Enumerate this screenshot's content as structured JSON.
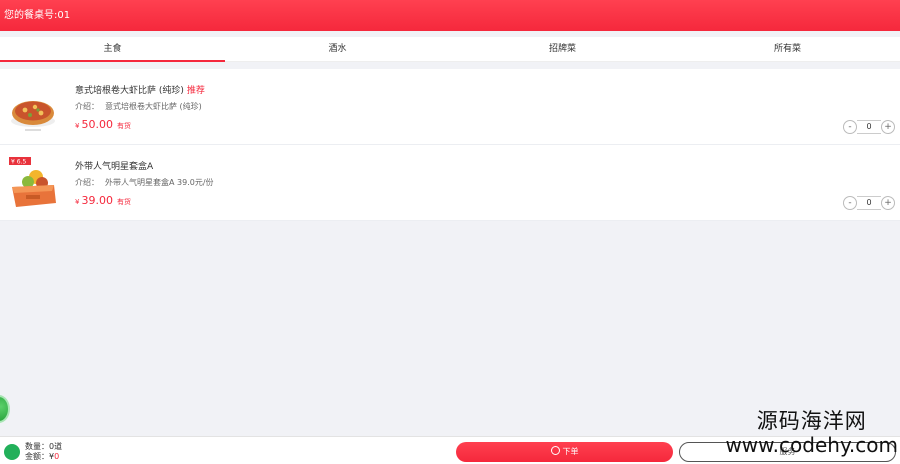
{
  "header": {
    "table_label": "您的餐桌号:01"
  },
  "tabs": [
    {
      "label": "主食",
      "active": true
    },
    {
      "label": "酒水",
      "active": false
    },
    {
      "label": "招牌菜",
      "active": false
    },
    {
      "label": "所有菜",
      "active": false
    }
  ],
  "items": [
    {
      "name": "意式培根卷大虾比萨 (纯珍)",
      "tag": "推荐",
      "desc_label": "介绍：",
      "desc": "意式培根卷大虾比萨 (纯珍)",
      "currency": "¥",
      "price": "50.00",
      "stock": "有货",
      "qty": "0",
      "image": "pizza"
    },
    {
      "name": "外带人气明星套盒A",
      "tag": "",
      "desc_label": "介绍：",
      "desc": "外带人气明星套盒A 39.0元/份",
      "currency": "¥",
      "price": "39.00",
      "stock": "有货",
      "qty": "0",
      "image": "meal-box",
      "badge": "¥ 6.5"
    }
  ],
  "stepper": {
    "minus": "-",
    "plus": "+"
  },
  "footer": {
    "qty_label": "数量：",
    "qty_value": "0道",
    "amount_label": "金额：¥",
    "amount_value": "0",
    "order_label": "下单",
    "service_label": "服务"
  },
  "watermark": {
    "cn": "源码海洋网",
    "url": "www.codehy.com"
  },
  "colors": {
    "accent": "#f5283c",
    "green": "#22b05a"
  }
}
